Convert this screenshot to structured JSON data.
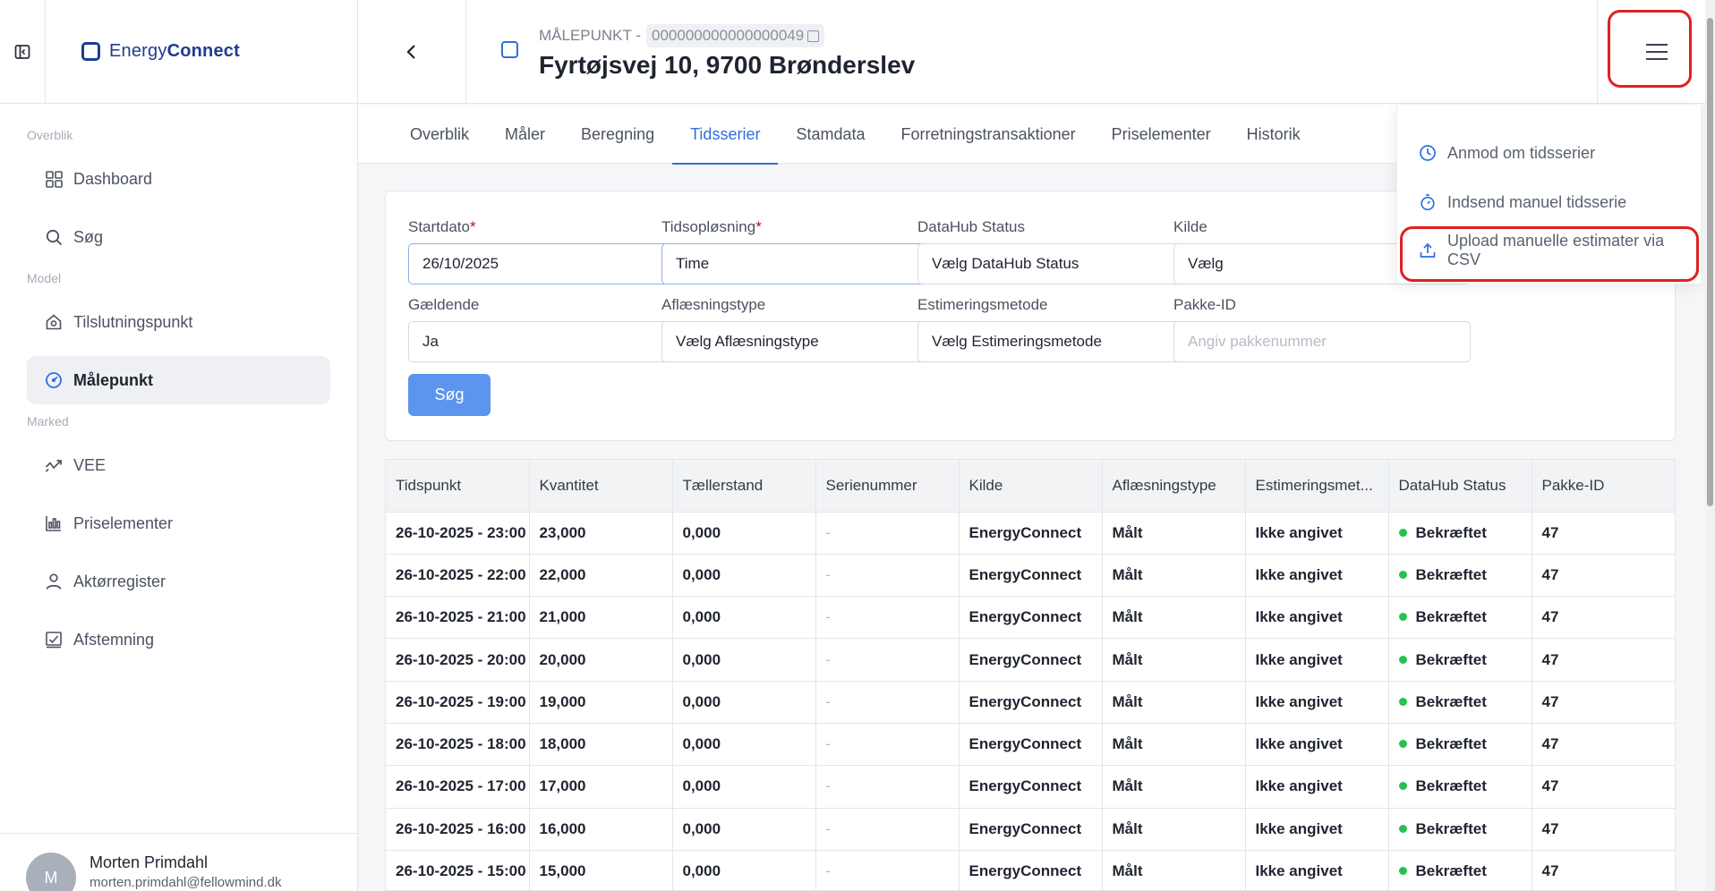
{
  "brand": {
    "name_part1": "Energy",
    "name_part2": "Connect"
  },
  "sidebar": {
    "sections": [
      {
        "label": "Overblik",
        "items": [
          {
            "label": "Dashboard",
            "icon": "grid-icon"
          },
          {
            "label": "Søg",
            "icon": "search-icon"
          }
        ]
      },
      {
        "label": "Model",
        "items": [
          {
            "label": "Tilslutningspunkt",
            "icon": "house-icon"
          },
          {
            "label": "Målepunkt",
            "icon": "gauge-icon",
            "active": true
          }
        ]
      },
      {
        "label": "Marked",
        "items": [
          {
            "label": "VEE",
            "icon": "trend-icon"
          },
          {
            "label": "Priselementer",
            "icon": "bar-chart-icon"
          },
          {
            "label": "Aktørregister",
            "icon": "user-icon"
          },
          {
            "label": "Afstemning",
            "icon": "check-chart-icon"
          }
        ]
      }
    ],
    "user": {
      "initial": "M",
      "name": "Morten Primdahl",
      "email": "morten.primdahl@fellowmind.dk"
    }
  },
  "header": {
    "label": "MÅLEPUNKT -",
    "id": "000000000000000049",
    "address": "Fyrtøjsvej 10, 9700 Brønderslev"
  },
  "tabs": [
    {
      "label": "Overblik"
    },
    {
      "label": "Måler"
    },
    {
      "label": "Beregning"
    },
    {
      "label": "Tidsserier",
      "active": true
    },
    {
      "label": "Stamdata"
    },
    {
      "label": "Forretningstransaktioner"
    },
    {
      "label": "Priselementer"
    },
    {
      "label": "Historik"
    }
  ],
  "filters": {
    "startdato": {
      "label": "Startdato",
      "value": "26/10/2025"
    },
    "tidsoplosning": {
      "label": "Tidsopløsning",
      "value": "Time"
    },
    "datahub_status": {
      "label": "DataHub Status",
      "value": "Vælg DataHub Status"
    },
    "kilde": {
      "label": "Kilde",
      "value": "Vælg"
    },
    "gaeldende": {
      "label": "Gældende",
      "value": "Ja"
    },
    "aflaesningstype": {
      "label": "Aflæsningstype",
      "value": "Vælg Aflæsningstype"
    },
    "estimeringsmetode": {
      "label": "Estimeringsmetode",
      "value": "Vælg Estimeringsmetode"
    },
    "pakke_id": {
      "label": "Pakke-ID",
      "placeholder": "Angiv pakkenummer"
    },
    "search_label": "Søg",
    "required_mark": "*"
  },
  "table": {
    "columns": [
      "Tidspunkt",
      "Kvantitet",
      "Tællerstand",
      "Serienummer",
      "Kilde",
      "Aflæsningstype",
      "Estimeringsmet...",
      "DataHub Status",
      "Pakke-ID"
    ],
    "rows": [
      [
        "26-10-2025 - 23:00",
        "23,000",
        "0,000",
        "-",
        "EnergyConnect",
        "Målt",
        "Ikke angivet",
        "Bekræftet",
        "47"
      ],
      [
        "26-10-2025 - 22:00",
        "22,000",
        "0,000",
        "-",
        "EnergyConnect",
        "Målt",
        "Ikke angivet",
        "Bekræftet",
        "47"
      ],
      [
        "26-10-2025 - 21:00",
        "21,000",
        "0,000",
        "-",
        "EnergyConnect",
        "Målt",
        "Ikke angivet",
        "Bekræftet",
        "47"
      ],
      [
        "26-10-2025 - 20:00",
        "20,000",
        "0,000",
        "-",
        "EnergyConnect",
        "Målt",
        "Ikke angivet",
        "Bekræftet",
        "47"
      ],
      [
        "26-10-2025 - 19:00",
        "19,000",
        "0,000",
        "-",
        "EnergyConnect",
        "Målt",
        "Ikke angivet",
        "Bekræftet",
        "47"
      ],
      [
        "26-10-2025 - 18:00",
        "18,000",
        "0,000",
        "-",
        "EnergyConnect",
        "Målt",
        "Ikke angivet",
        "Bekræftet",
        "47"
      ],
      [
        "26-10-2025 - 17:00",
        "17,000",
        "0,000",
        "-",
        "EnergyConnect",
        "Målt",
        "Ikke angivet",
        "Bekræftet",
        "47"
      ],
      [
        "26-10-2025 - 16:00",
        "16,000",
        "0,000",
        "-",
        "EnergyConnect",
        "Målt",
        "Ikke angivet",
        "Bekræftet",
        "47"
      ],
      [
        "26-10-2025 - 15:00",
        "15,000",
        "0,000",
        "-",
        "EnergyConnect",
        "Målt",
        "Ikke angivet",
        "Bekræftet",
        "47"
      ]
    ]
  },
  "dropdown": {
    "items": [
      {
        "label": "Anmod om tidsserier",
        "icon": "clock-icon"
      },
      {
        "label": "Indsend manuel tidsserie",
        "icon": "stopwatch-icon"
      },
      {
        "label": "Upload manuelle estimater via CSV",
        "icon": "upload-icon"
      }
    ]
  },
  "colors": {
    "accent": "#2f6fe0",
    "brand": "#1d3d8f",
    "highlight": "#e02020",
    "status_ok": "#28c050",
    "button": "#5b95ee"
  }
}
